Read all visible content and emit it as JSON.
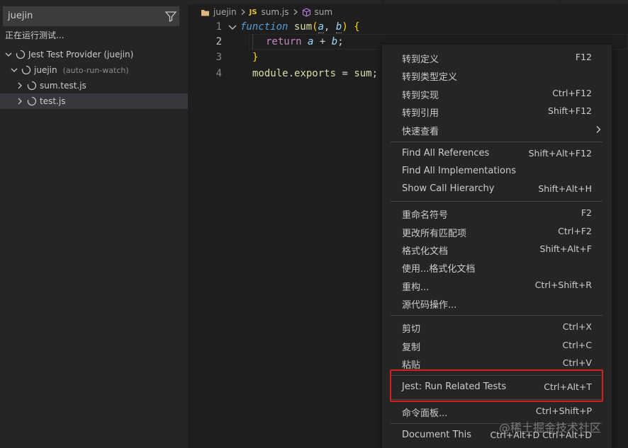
{
  "sidebar": {
    "filter_value": "juejin",
    "status": "正在运行测试...",
    "tree": [
      {
        "label": "Jest Test Provider (juejin)",
        "desc": ""
      },
      {
        "label": "juejin",
        "desc": "(auto-run-watch)"
      },
      {
        "label": "sum.test.js",
        "desc": ""
      },
      {
        "label": "test.js",
        "desc": ""
      }
    ]
  },
  "breadcrumb": {
    "folder": "juejin",
    "file_badge": "JS",
    "file": "sum.js",
    "symbol": "sum"
  },
  "code": {
    "line_numbers": [
      "1",
      "2",
      "3",
      "4"
    ],
    "l1": {
      "kw": "function",
      "fn": "sum",
      "open": "(",
      "p1": "a",
      "comma": ", ",
      "p2": "b",
      "close": ")",
      "space": " ",
      "brace": "{"
    },
    "l2": {
      "ret": "return",
      "a": "a",
      "plus": " + ",
      "b": "b",
      "semi": ";"
    },
    "l3": {
      "brace": "}"
    },
    "l4": {
      "obj": "module",
      "dot": ".",
      "prop": "exports",
      "eq": " = ",
      "val": "sum",
      "semi": ";"
    }
  },
  "menu": {
    "groups": [
      [
        {
          "label": "转到定义",
          "key": "F12"
        },
        {
          "label": "转到类型定义",
          "key": ""
        },
        {
          "label": "转到实现",
          "key": "Ctrl+F12"
        },
        {
          "label": "转到引用",
          "key": "Shift+F12"
        },
        {
          "label": "快速查看",
          "key": "",
          "submenu": true
        }
      ],
      [
        {
          "label": "Find All References",
          "key": "Shift+Alt+F12"
        },
        {
          "label": "Find All Implementations",
          "key": ""
        },
        {
          "label": "Show Call Hierarchy",
          "key": "Shift+Alt+H"
        }
      ],
      [
        {
          "label": "重命名符号",
          "key": "F2"
        },
        {
          "label": "更改所有匹配项",
          "key": "Ctrl+F2"
        },
        {
          "label": "格式化文档",
          "key": "Shift+Alt+F"
        },
        {
          "label": "使用...格式化文档",
          "key": ""
        },
        {
          "label": "重构...",
          "key": "Ctrl+Shift+R"
        },
        {
          "label": "源代码操作...",
          "key": ""
        }
      ],
      [
        {
          "label": "剪切",
          "key": "Ctrl+X"
        },
        {
          "label": "复制",
          "key": "Ctrl+C"
        },
        {
          "label": "粘贴",
          "key": "Ctrl+V"
        }
      ],
      [
        {
          "label": "Jest: Run Related Tests",
          "key": "Ctrl+Alt+T"
        }
      ],
      [
        {
          "label": "命令面板...",
          "key": "Ctrl+Shift+P"
        }
      ],
      [
        {
          "label": "Document This",
          "key": "Ctrl+Alt+D Ctrl+Alt+D"
        }
      ]
    ]
  },
  "watermark": "@稀土掘金技术社区",
  "colors": {
    "highlight": "#d81e1e",
    "menu_bg": "#252526",
    "editor_bg": "#1e1e1e"
  }
}
